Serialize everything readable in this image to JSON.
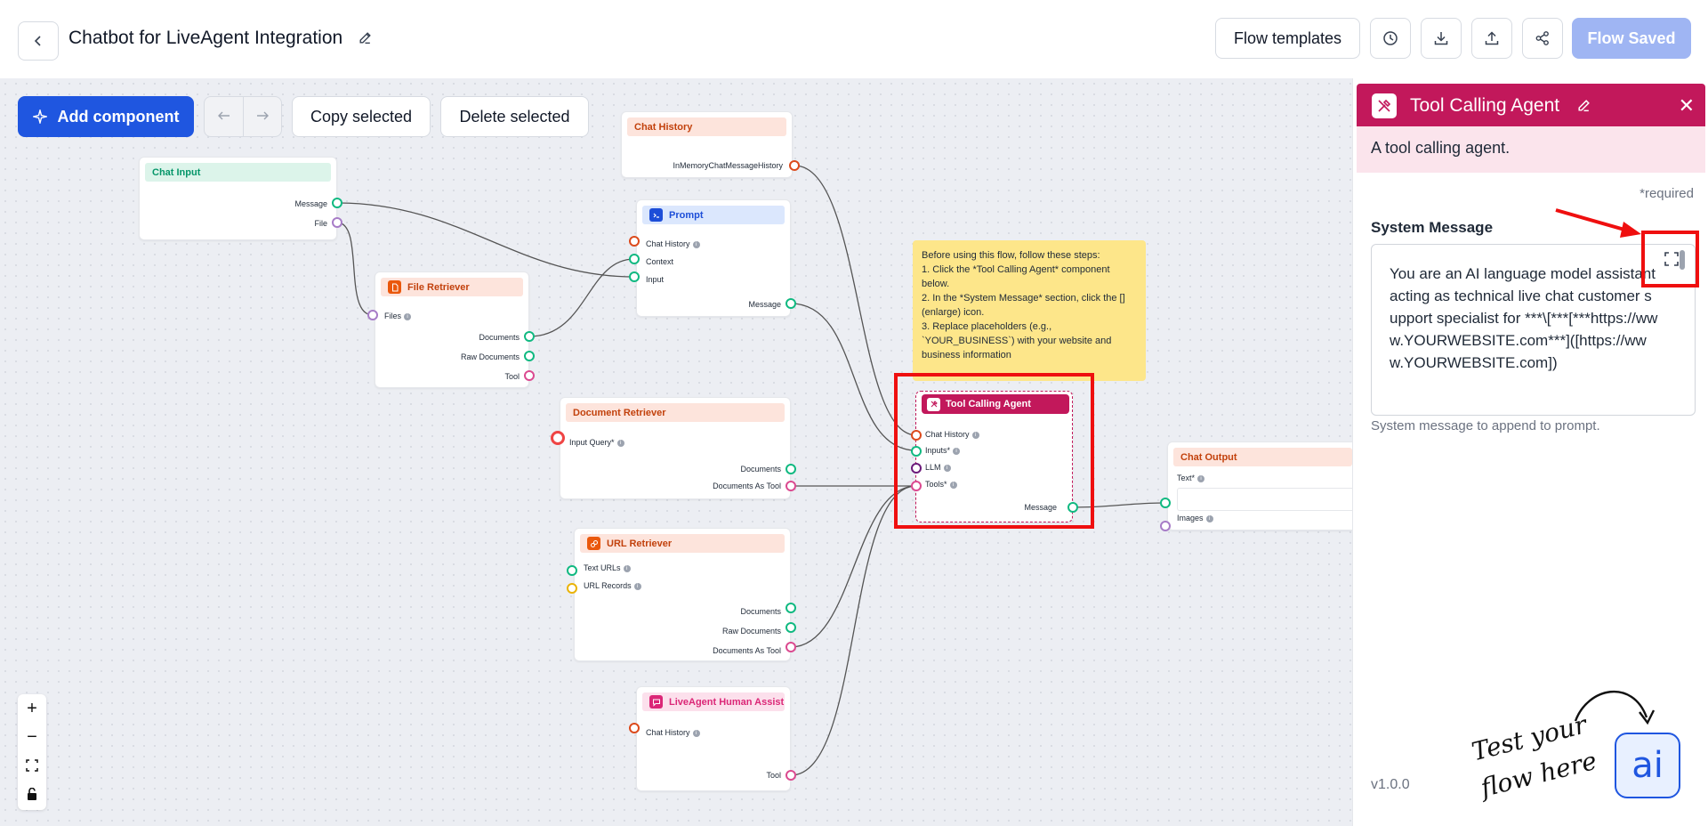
{
  "header": {
    "title": "Chatbot for LiveAgent Integration",
    "flow_templates": "Flow templates",
    "flow_saved": "Flow Saved"
  },
  "toolbar": {
    "add_component": "Add component",
    "copy_selected": "Copy selected",
    "delete_selected": "Delete selected"
  },
  "nodes": {
    "chat_input": {
      "title": "Chat Input",
      "message": "Message",
      "file": "File"
    },
    "chat_history": {
      "title": "Chat History",
      "output": "InMemoryChatMessageHistory"
    },
    "prompt": {
      "title": "Prompt",
      "chat_history": "Chat History",
      "context": "Context",
      "input": "Input",
      "message": "Message"
    },
    "file_retriever": {
      "title": "File Retriever",
      "files": "Files",
      "documents": "Documents",
      "raw_documents": "Raw Documents",
      "tool": "Tool"
    },
    "document_retriever": {
      "title": "Document Retriever",
      "input_query": "Input Query*",
      "documents": "Documents",
      "documents_as_tool": "Documents As Tool"
    },
    "url_retriever": {
      "title": "URL Retriever",
      "text_urls": "Text URLs",
      "url_records": "URL Records",
      "documents": "Documents",
      "raw_documents": "Raw Documents",
      "documents_as_tool": "Documents As Tool"
    },
    "liveagent": {
      "title": "LiveAgent Human Assist",
      "chat_history": "Chat History",
      "tool": "Tool"
    },
    "tool_calling_agent": {
      "title": "Tool Calling Agent",
      "chat_history": "Chat History",
      "inputs": "Inputs*",
      "llm": "LLM",
      "tools": "Tools*",
      "message": "Message"
    },
    "chat_output": {
      "title": "Chat Output",
      "text": "Text*",
      "images": "Images"
    }
  },
  "note": {
    "lines": [
      "Before using this flow, follow these steps:",
      "1. Click the *Tool Calling Agent* component below.",
      "2. In the *System Message* section, click the [] (enlarge) icon.",
      "3. Replace placeholders (e.g., `YOUR_BUSINESS`) with your website and business information"
    ]
  },
  "panel": {
    "title": "Tool Calling Agent",
    "description": "A tool calling agent.",
    "required": "*required",
    "system_message_label": "System Message",
    "system_message_value": "You are an AI language model assistant acting as technical live chat customer support specialist for ***\\[***[***https://www.YOURWEBSITE.com***]([https://www.YOURWEBSITE.com])",
    "hint": "System message to append to prompt.",
    "version": "v1.0.0",
    "test_text": "Test your flow here",
    "ai_label": "ai"
  },
  "colors": {
    "primary": "#1f56e0",
    "agent": "#c2185b",
    "highlight": "#ef0f0f",
    "note": "#fde68a",
    "edge": "#555555"
  }
}
